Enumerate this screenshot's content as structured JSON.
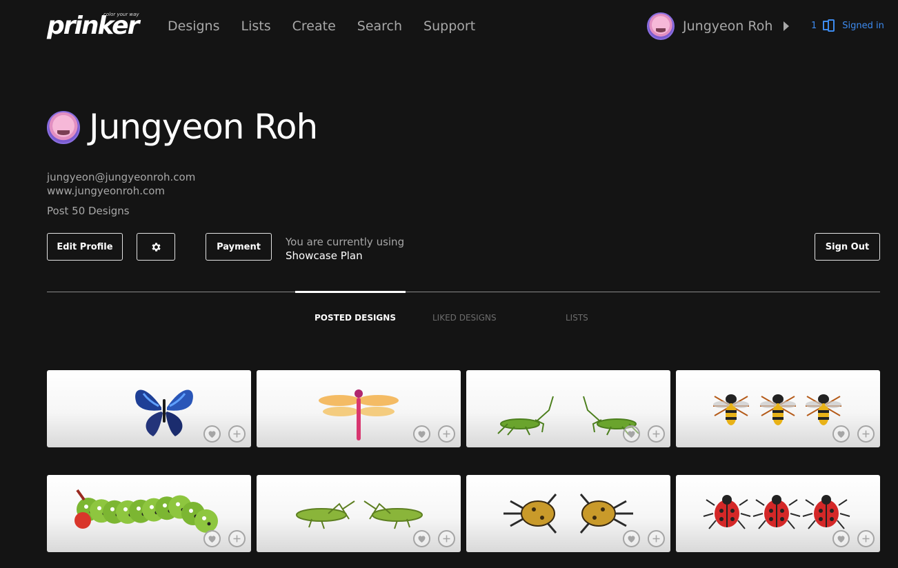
{
  "brand": {
    "name": "prinker",
    "tagline": "color your way"
  },
  "nav": {
    "items": [
      "Designs",
      "Lists",
      "Create",
      "Search",
      "Support"
    ]
  },
  "user_menu": {
    "name": "Jungyeon Roh"
  },
  "session": {
    "count": "1",
    "label": "Signed in",
    "color": "#3d8bf0"
  },
  "profile": {
    "name": "Jungyeon Roh",
    "email": "jungyeon@jungyeonroh.com",
    "website": "www.jungyeonroh.com",
    "posts": "Post 50 Designs"
  },
  "actions": {
    "edit_label": "Edit Profile",
    "payment_label": "Payment",
    "plan_prefix": "You are currently using",
    "plan_name": "Showcase Plan",
    "signout_label": "Sign Out"
  },
  "tabs": [
    {
      "label": "POSTED DESIGNS",
      "active": true
    },
    {
      "label": "LIKED DESIGNS",
      "active": false
    },
    {
      "label": "LISTS",
      "active": false
    }
  ],
  "designs": [
    {
      "subject": "blue butterfly",
      "icon": "butterfly"
    },
    {
      "subject": "orange dragonfly",
      "icon": "dragonfly"
    },
    {
      "subject": "two praying mantises",
      "icon": "mantis"
    },
    {
      "subject": "three wasps",
      "icon": "wasp"
    },
    {
      "subject": "green caterpillar",
      "icon": "caterpillar"
    },
    {
      "subject": "two grasshoppers",
      "icon": "grasshopper"
    },
    {
      "subject": "two stag beetles",
      "icon": "beetle"
    },
    {
      "subject": "three ladybugs",
      "icon": "ladybug"
    }
  ],
  "colors": {
    "background": "#141414",
    "muted_text": "#a8a8a8",
    "accent": "#3d8bf0"
  }
}
